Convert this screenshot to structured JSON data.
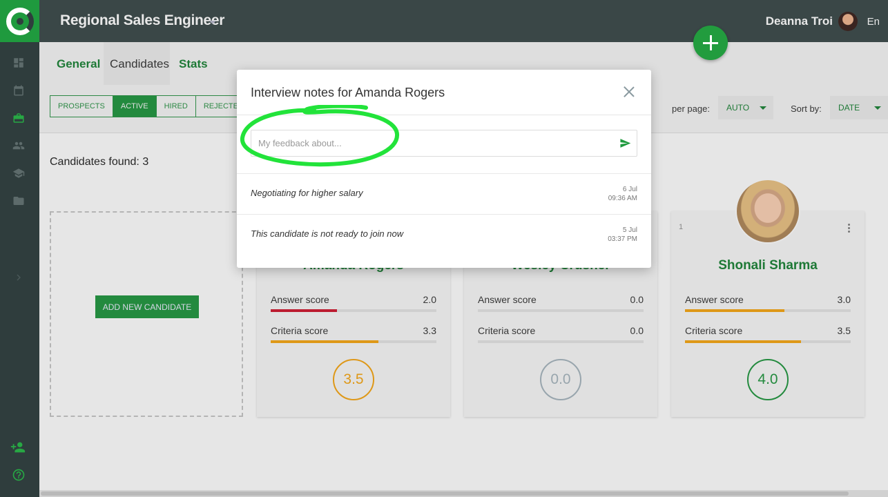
{
  "header": {
    "job_title": "Regional Sales Engineer",
    "user_name": "Deanna Troi",
    "language": "En"
  },
  "tabs": [
    {
      "label": "General"
    },
    {
      "label": "Candidates"
    },
    {
      "label": "Stats"
    }
  ],
  "filters": {
    "stages": [
      "PROSPECTS",
      "ACTIVE",
      "HIRED",
      "REJECTED"
    ],
    "selected_stage": "ACTIVE",
    "per_page_label": "per page:",
    "per_page_value": "AUTO",
    "sort_label": "Sort by:",
    "sort_value": "DATE"
  },
  "candidates_found": "Candidates found: 3",
  "add_candidate_label": "ADD NEW CANDIDATE",
  "cards": [
    {
      "name": "Amanda Rogers",
      "answer_label": "Answer score",
      "answer": "2.0",
      "answer_frac": 0.4,
      "answer_color": "#c0182d",
      "criteria_label": "Criteria score",
      "criteria": "3.3",
      "criteria_frac": 0.65,
      "criteria_color": "#e49a14",
      "total": "3.5",
      "total_color": "#e49a14"
    },
    {
      "name": "Wesley Crusher",
      "answer_label": "Answer score",
      "answer": "0.0",
      "answer_frac": 0,
      "answer_color": "#e49a14",
      "criteria_label": "Criteria score",
      "criteria": "0.0",
      "criteria_frac": 0,
      "criteria_color": "#e49a14",
      "total": "0.0",
      "total_color": "#9aa8b0"
    },
    {
      "number": "1",
      "name": "Shonali Sharma",
      "answer_label": "Answer score",
      "answer": "3.0",
      "answer_frac": 0.6,
      "answer_color": "#e49a14",
      "criteria_label": "Criteria score",
      "criteria": "3.5",
      "criteria_frac": 0.7,
      "criteria_color": "#e49a14",
      "total": "4.0",
      "total_color": "#1f8c3b"
    }
  ],
  "modal": {
    "title": "Interview notes for Amanda Rogers",
    "placeholder": "My feedback about...",
    "notes": [
      {
        "text": "Negotiating for higher salary",
        "date": "6 Jul",
        "time": "09:36 AM"
      },
      {
        "text": "This candidate is not ready to join now",
        "date": "5 Jul",
        "time": "03:37 PM"
      }
    ]
  },
  "colors": {
    "brand": "#1f8c3b",
    "sidebar": "#2f3d3d",
    "topbar": "#3a4747",
    "highlight": "#22e33a"
  }
}
